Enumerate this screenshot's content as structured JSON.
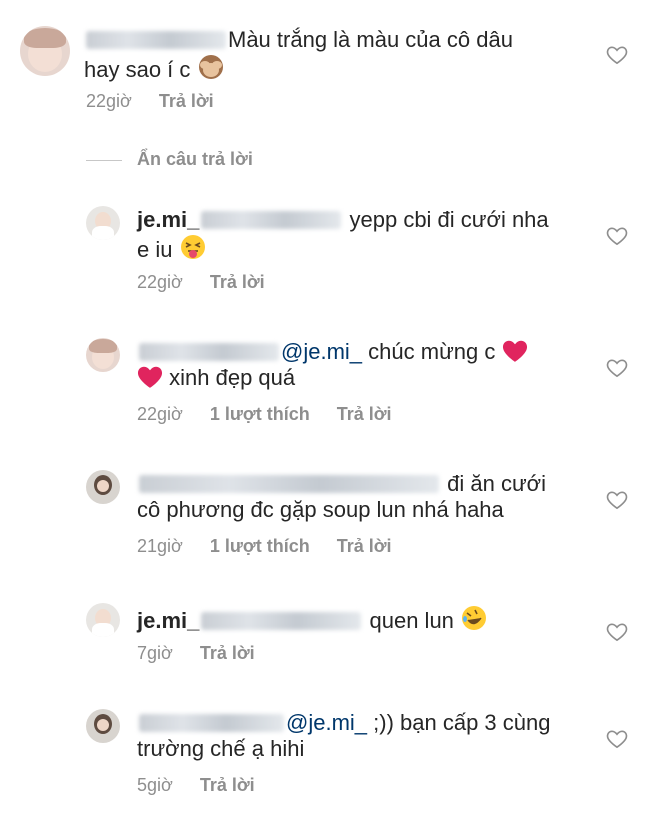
{
  "comments": [
    {
      "username": "",
      "text_line1": "Màu trắng là màu của cô dâu",
      "text_line2": "hay sao í c",
      "emoji": "see-no-evil-monkey",
      "time": "22giờ",
      "likes": "",
      "reply_label": "Trả lời"
    },
    {
      "username": "je.mi_",
      "mention": "",
      "text_line1": "yepp cbi đi cưới nha",
      "text_line2": "e iu",
      "emoji": "tongue-squint-face",
      "time": "22giờ",
      "likes": "",
      "reply_label": "Trả lời"
    },
    {
      "username": "",
      "mention": "@je.mi_",
      "text_line1": "chúc mừng c",
      "text_line2": "xinh đẹp quá",
      "emoji": "red-heart",
      "time": "22giờ",
      "likes": "1 lượt thích",
      "reply_label": "Trả lời"
    },
    {
      "username": "",
      "mention": "",
      "text_line1": "đi ăn cưới",
      "text_line2": "cô phương đc gặp soup lun nhá haha",
      "emoji": "",
      "time": "21giờ",
      "likes": "1 lượt thích",
      "reply_label": "Trả lời"
    },
    {
      "username": "je.mi_",
      "mention": "",
      "text_line1": "quen lun",
      "text_line2": "",
      "emoji": "rolling-laughing-face",
      "time": "7giờ",
      "likes": "",
      "reply_label": "Trả lời"
    },
    {
      "username": "",
      "mention": "@je.mi_",
      "text_line1": ";)) bạn cấp 3 cùng",
      "text_line2": "trường chế ạ hihi",
      "emoji": "",
      "time": "5giờ",
      "likes": "",
      "reply_label": "Trả lời"
    }
  ],
  "hide_replies_label": "Ẩn câu trả lời",
  "colors": {
    "text": "#262626",
    "meta": "#8e8e8e",
    "mention": "#00376b",
    "heart": "#8e8e8e",
    "red": "#e0245e"
  }
}
